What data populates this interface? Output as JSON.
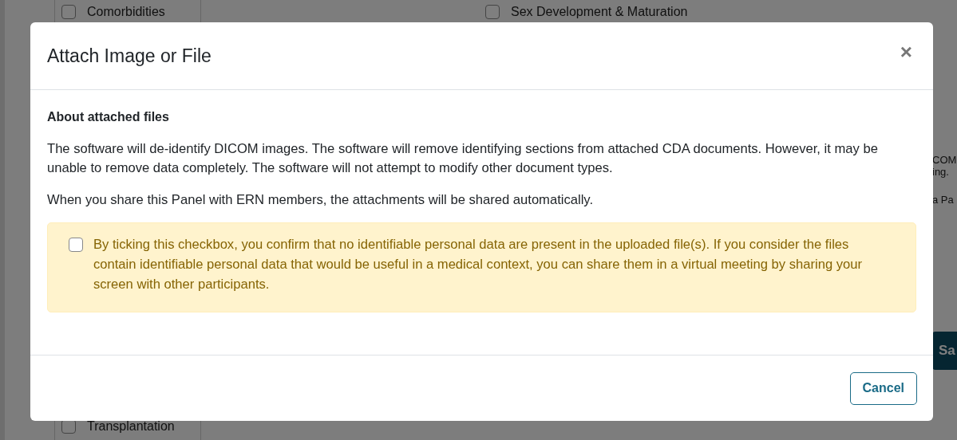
{
  "background_page": {
    "left_list": [
      {
        "label": "Comorbidities",
        "checked": false
      },
      {
        "label": "Transplantation",
        "checked": false
      }
    ],
    "middle_list": [
      {
        "label": "Sex Development & Maturation",
        "checked": false
      }
    ],
    "right_fragments": [
      "COM",
      "ing.",
      "a Pa"
    ],
    "save_button": "Sa"
  },
  "dialog": {
    "title": "Attach Image or File",
    "close": "×",
    "section_heading": "About attached files",
    "paragraphs": [
      "The software will de-identify DICOM images. The software will remove identifying sections from attached CDA documents. However, it may be unable to remove data completely. The software will not attempt to modify other document types.",
      "When you share this Panel with ERN members, the attachments will be shared automatically."
    ],
    "consent": {
      "checked": false,
      "text": "By ticking this checkbox, you confirm that no identifiable personal data are present in the uploaded file(s). If you consider the files contain identifiable personal data that would be useful in a medical context, you can share them in a virtual meeting by sharing your screen with other participants."
    },
    "buttons": [
      {
        "label": "Cancel",
        "kind": "outline"
      }
    ]
  }
}
